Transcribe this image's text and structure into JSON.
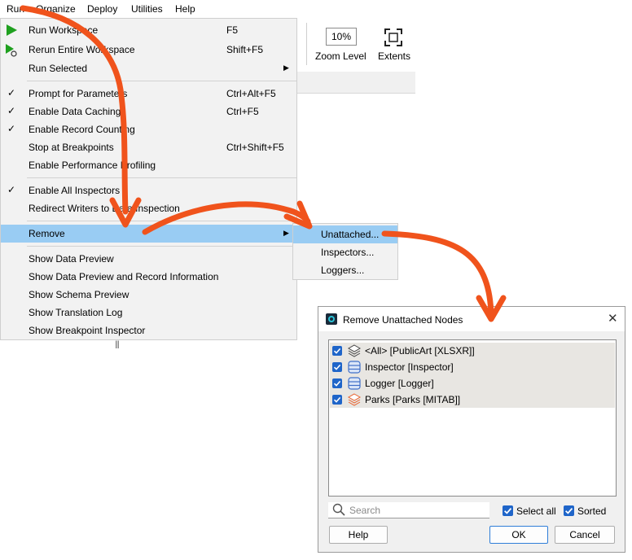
{
  "menubar": [
    "Run",
    "Organize",
    "Deploy",
    "Utilities",
    "Help"
  ],
  "toolbar": {
    "zoom_value": "10%",
    "zoom_label": "Zoom Level",
    "extents_label": "Extents"
  },
  "run_menu": {
    "items": [
      {
        "label": "Run Workspace",
        "shortcut": "F5",
        "check": "",
        "icon": "run-play-icon"
      },
      {
        "label": "Rerun Entire Workspace",
        "shortcut": "Shift+F5",
        "check": "",
        "icon": "rerun-icon"
      },
      {
        "label": "Run Selected",
        "shortcut": "",
        "check": "",
        "submenu": true
      },
      {
        "label": "Prompt for Parameters",
        "shortcut": "Ctrl+Alt+F5",
        "check": "✓"
      },
      {
        "label": "Enable Data Caching",
        "shortcut": "Ctrl+F5",
        "check": "✓"
      },
      {
        "label": "Enable Record Counting",
        "shortcut": "",
        "check": "✓"
      },
      {
        "label": "Stop at Breakpoints",
        "shortcut": "Ctrl+Shift+F5",
        "check": ""
      },
      {
        "label": "Enable Performance Profiling",
        "shortcut": "",
        "check": ""
      },
      {
        "label": "Enable All Inspectors",
        "shortcut": "",
        "check": "✓"
      },
      {
        "label": "Redirect Writers to Data Inspection",
        "shortcut": "",
        "check": ""
      },
      {
        "label": "Remove",
        "shortcut": "",
        "check": "",
        "submenu": true
      },
      {
        "label": "Show Data Preview",
        "shortcut": "",
        "check": ""
      },
      {
        "label": "Show Data Preview and Record Information",
        "shortcut": "",
        "check": ""
      },
      {
        "label": "Show Schema Preview",
        "shortcut": "",
        "check": ""
      },
      {
        "label": "Show Translation Log",
        "shortcut": "",
        "check": ""
      },
      {
        "label": "Show Breakpoint Inspector",
        "shortcut": "",
        "check": ""
      }
    ],
    "submenu_arrow": "▶",
    "grip": "|||"
  },
  "remove_submenu": [
    "Unattached...",
    "Inspectors...",
    "Loggers..."
  ],
  "dialog": {
    "title": "Remove Unattached Nodes",
    "close": "✕",
    "items": [
      {
        "label": "<All> [PublicArt [XLSXR]]",
        "icon": "layers-stack-icon",
        "checked": true
      },
      {
        "label": "Inspector [Inspector]",
        "icon": "inspector-db-icon",
        "checked": true
      },
      {
        "label": "Logger [Logger]",
        "icon": "logger-db-icon",
        "checked": true
      },
      {
        "label": "Parks [Parks [MITAB]]",
        "icon": "mitab-layers-icon",
        "checked": true
      }
    ],
    "search_placeholder": "Search",
    "select_all_label": "Select all",
    "sorted_label": "Sorted",
    "help_label": "Help",
    "ok_label": "OK",
    "cancel_label": "Cancel"
  },
  "colors": {
    "highlight": "#99ccf3",
    "arrow": "#f0531c",
    "checkbox": "#1f65c9",
    "play": "#1fa01f"
  }
}
